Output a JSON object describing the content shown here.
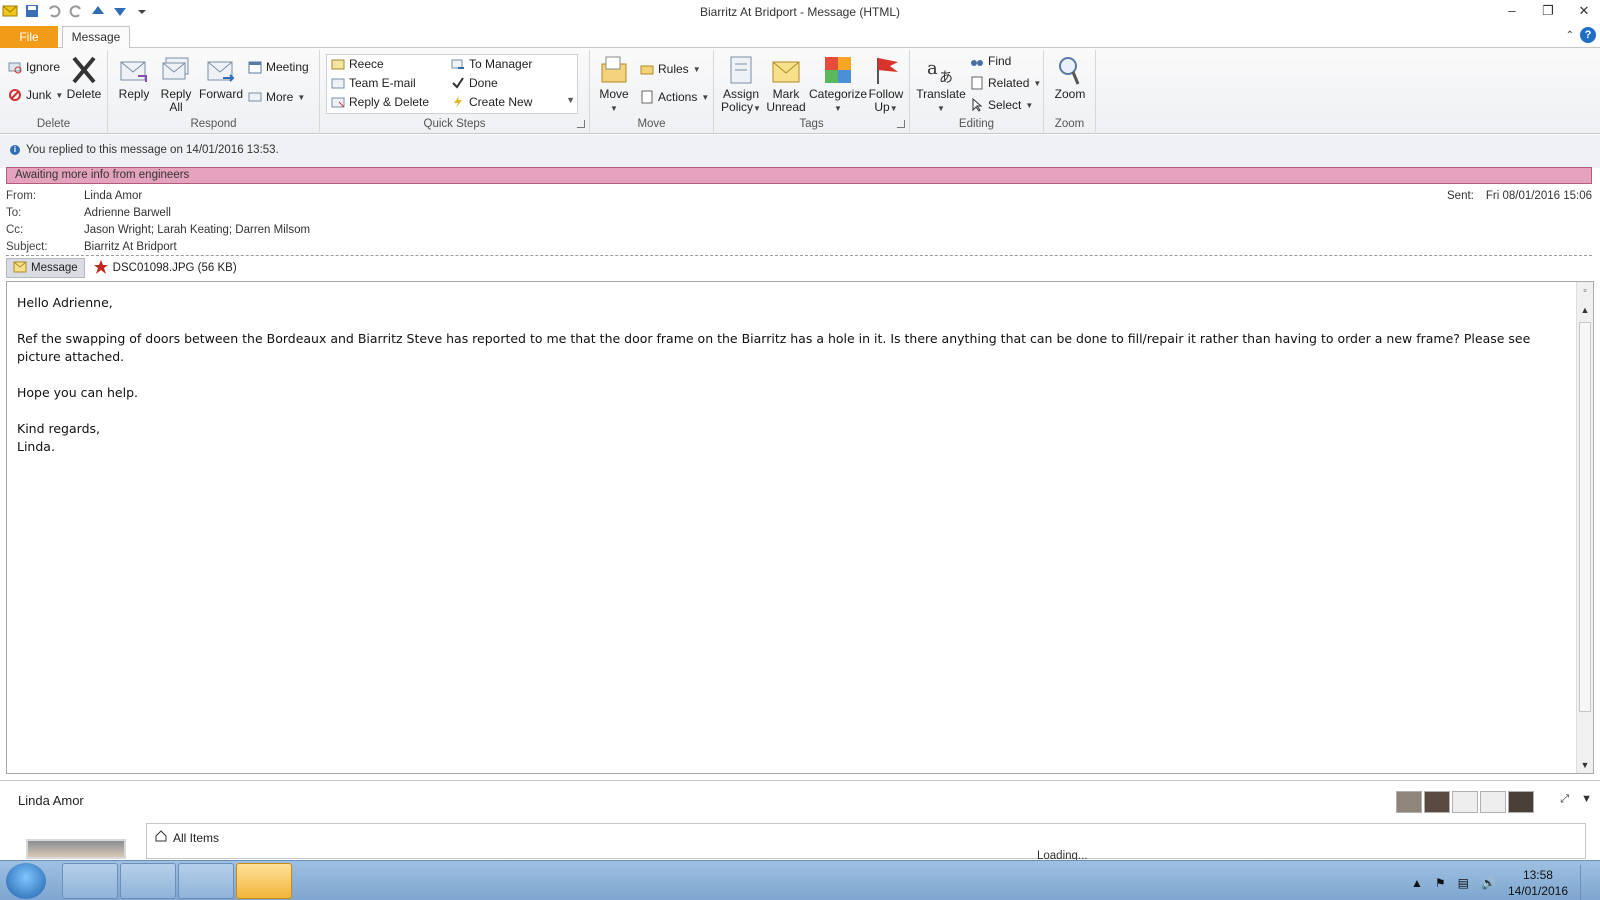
{
  "window": {
    "title": "Biarritz At Bridport  -  Message (HTML)"
  },
  "tabs": {
    "file": "File",
    "message": "Message"
  },
  "ribbon": {
    "delete_group": {
      "label": "Delete",
      "ignore": "Ignore",
      "junk": "Junk",
      "delete": "Delete"
    },
    "respond_group": {
      "label": "Respond",
      "reply": "Reply",
      "reply_all_1": "Reply",
      "reply_all_2": "All",
      "forward": "Forward",
      "meeting": "Meeting",
      "more": "More"
    },
    "quick_steps": {
      "label": "Quick Steps",
      "items": [
        "Reece",
        "To Manager",
        "Team E-mail",
        "Done",
        "Reply & Delete",
        "Create New"
      ]
    },
    "move_group": {
      "label": "Move",
      "move": "Move",
      "rules": "Rules",
      "actions": "Actions"
    },
    "tags_group": {
      "label": "Tags",
      "assign_policy_1": "Assign",
      "assign_policy_2": "Policy",
      "mark_unread_1": "Mark",
      "mark_unread_2": "Unread",
      "categorize": "Categorize",
      "follow_up_1": "Follow",
      "follow_up_2": "Up"
    },
    "editing_group": {
      "label": "Editing",
      "translate": "Translate",
      "find": "Find",
      "related": "Related",
      "select": "Select"
    },
    "zoom_group": {
      "label": "Zoom",
      "zoom": "Zoom"
    }
  },
  "info": {
    "replied": "You replied to this message on 14/01/2016 13:53.",
    "flag": "Awaiting more info from engineers"
  },
  "header": {
    "from_label": "From:",
    "from": "Linda Amor",
    "to_label": "To:",
    "to": "Adrienne Barwell",
    "cc_label": "Cc:",
    "cc": "Jason Wright; Larah Keating; Darren Milsom",
    "subject_label": "Subject:",
    "subject": "Biarritz At Bridport",
    "sent_label": "Sent:",
    "sent": "Fri 08/01/2016 15:06"
  },
  "attachments": {
    "message": "Message",
    "file": "DSC01098.JPG (56 KB)"
  },
  "body": {
    "greeting": "Hello Adrienne,",
    "para1": "Ref the swapping of doors between the Bordeaux and Biarritz Steve has reported to me that the door frame on the Biarritz has a hole in it.  Is there anything that can be done to fill/repair it rather than having to order a new frame?  Please see picture attached.",
    "para2": "Hope you can help.",
    "closing": "Kind regards,",
    "signature": "Linda."
  },
  "people_pane": {
    "name": "Linda Amor",
    "all_items": "All Items",
    "loading": "Loading..."
  },
  "taskbar": {
    "time": "13:58",
    "date": "14/01/2016"
  },
  "colors": {
    "file_tab": "#f29b19",
    "flag_bar": "#e4a2bd",
    "taskbar": "#8fb3d8"
  }
}
